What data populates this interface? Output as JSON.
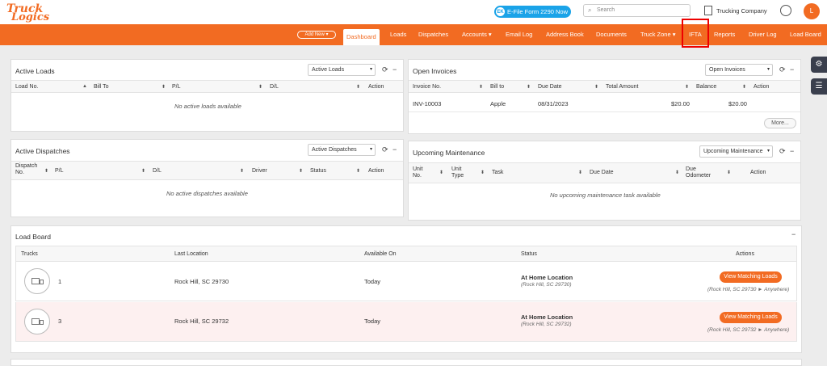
{
  "header": {
    "logo_line1": "Truck",
    "logo_line2": "Logics",
    "efile_icon": "EK",
    "efile_label": "E-File Form 2290 Now",
    "search_placeholder": "Search",
    "company": "Trucking Company",
    "avatar_initial": "L"
  },
  "nav": {
    "add_new": "Add New ▾",
    "items": [
      "Dashboard",
      "Loads",
      "Dispatches",
      "Accounts ▾",
      "Email Log",
      "Address Book",
      "Documents",
      "Truck Zone ▾",
      "IFTA",
      "Reports",
      "Driver Log",
      "Load Board"
    ],
    "active": "Dashboard",
    "highlighted": "IFTA"
  },
  "active_loads": {
    "title": "Active Loads",
    "select": "Active Loads",
    "columns": [
      "Load No.",
      "Bill To",
      "P/L",
      "D/L",
      "Action"
    ],
    "empty": "No active loads available"
  },
  "open_invoices": {
    "title": "Open Invoices",
    "select": "Open Invoices",
    "columns": [
      "Invoice No.",
      "Bill to",
      "Due Date",
      "Total Amount",
      "Balance",
      "Action"
    ],
    "rows": [
      {
        "invoice": "INV-10003",
        "bill_to": "Apple",
        "due": "08/31/2023",
        "total": "$20.00",
        "balance": "$20.00"
      }
    ],
    "more": "More..."
  },
  "active_dispatches": {
    "title": "Active Dispatches",
    "select": "Active Dispatches",
    "columns": [
      "Dispatch No.",
      "P/L",
      "D/L",
      "Driver",
      "Status",
      "Action"
    ],
    "empty": "No active dispatches available"
  },
  "maintenance": {
    "title": "Upcoming Maintenance",
    "select": "Upcoming Maintenance",
    "columns": [
      "Unit No.",
      "Unit Type",
      "Task",
      "Due Date",
      "Due Odometer",
      "Action"
    ],
    "empty": "No upcoming maintenance task available"
  },
  "load_board": {
    "title": "Load Board",
    "columns": [
      "Trucks",
      "Last Location",
      "Available On",
      "Status",
      "Actions"
    ],
    "rows": [
      {
        "truck": "1",
        "location": "Rock Hill, SC 29730",
        "available": "Today",
        "status": "At Home Location",
        "status_sub": "(Rock Hill, SC 29730)",
        "action": "View Matching Loads",
        "route": "(Rock Hill, SC 29730 ► Anywhere)"
      },
      {
        "truck": "3",
        "location": "Rock Hill, SC 29732",
        "available": "Today",
        "status": "At Home Location",
        "status_sub": "(Rock Hill, SC 29732)",
        "action": "View Matching Loads",
        "route": "(Rock Hill, SC 29732 ► Anywhere)"
      }
    ]
  },
  "colors": {
    "brand": "#f26b22",
    "efile": "#1aa3e8",
    "highlight_row": "#fdf0f0",
    "annotation": "#e00000"
  }
}
